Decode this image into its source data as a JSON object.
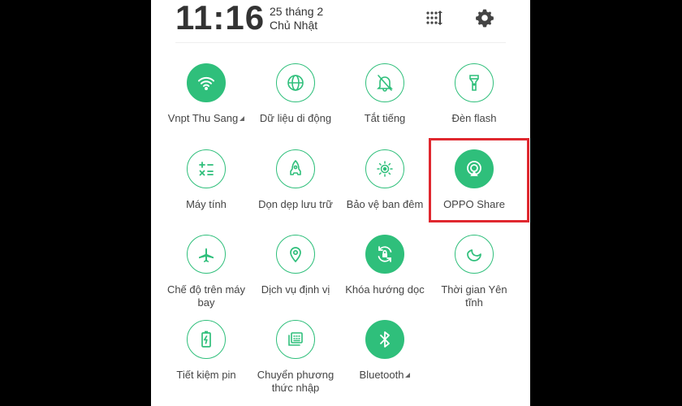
{
  "status_header": {
    "time": "11:16",
    "date": "25 tháng 2",
    "weekday": "Chủ Nhật",
    "edit_icon": "grid-edit-icon",
    "settings_icon": "gear-icon"
  },
  "colors": {
    "accent": "#2fbf7b",
    "highlight": "#e0282f"
  },
  "tiles": [
    {
      "label": "Vnpt Thu Sang",
      "icon": "wifi-icon",
      "active": true,
      "has_menu": true
    },
    {
      "label": "Dữ liệu di động",
      "icon": "globe-icon",
      "active": false
    },
    {
      "label": "Tắt tiếng",
      "icon": "bell-off-icon",
      "active": false
    },
    {
      "label": "Đèn flash",
      "icon": "flashlight-icon",
      "active": false
    },
    {
      "label": "Máy tính",
      "icon": "calculator-icon",
      "active": false
    },
    {
      "label": "Dọn dẹp lưu trữ",
      "icon": "rocket-icon",
      "active": false
    },
    {
      "label": "Bảo vệ ban đêm",
      "icon": "eye-sun-icon",
      "active": false
    },
    {
      "label": "OPPO Share",
      "icon": "oppo-share-icon",
      "active": true,
      "highlighted": true
    },
    {
      "label": "Chế độ trên máy bay",
      "icon": "airplane-icon",
      "active": false
    },
    {
      "label": "Dịch vụ định vị",
      "icon": "location-pin-icon",
      "active": false
    },
    {
      "label": "Khóa hướng dọc",
      "icon": "rotation-lock-icon",
      "active": true
    },
    {
      "label": "Thời gian Yên tĩnh",
      "icon": "moon-icon",
      "active": false
    },
    {
      "label": "Tiết kiệm pin",
      "icon": "battery-saver-icon",
      "active": false
    },
    {
      "label": "Chuyển phương thức nhập",
      "icon": "keyboard-icon",
      "active": false
    },
    {
      "label": "Bluetooth",
      "icon": "bluetooth-icon",
      "active": true,
      "has_menu": true
    }
  ]
}
